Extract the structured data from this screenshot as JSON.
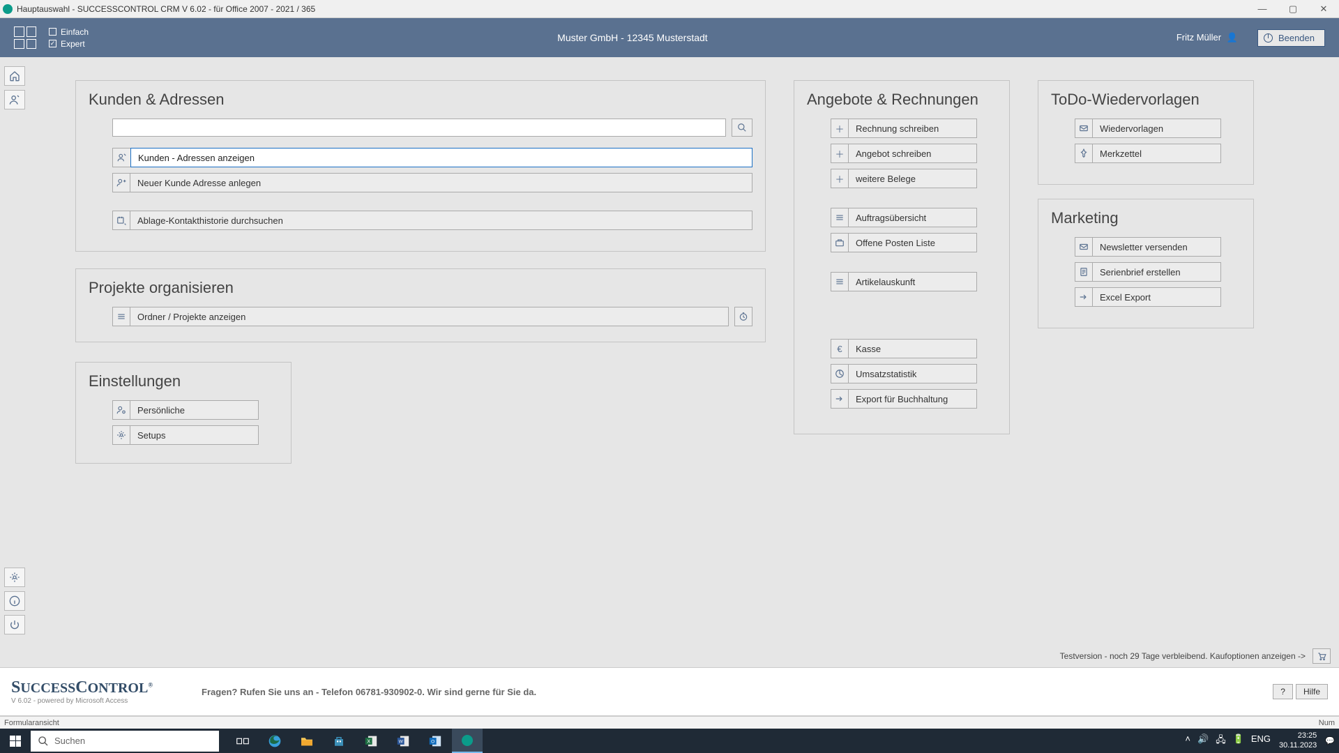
{
  "titlebar": {
    "title": "Hauptauswahl - SUCCESSCONTROL CRM V 6.02 - für Office 2007 - 2021 / 365"
  },
  "banner": {
    "mode_simple": "Einfach",
    "mode_expert": "Expert",
    "center": "Muster GmbH - 12345 Musterstadt",
    "user": "Fritz Müller",
    "exit": "Beenden"
  },
  "customers": {
    "title": "Kunden & Adressen",
    "show": "Kunden - Adressen anzeigen",
    "new": "Neuer Kunde Adresse anlegen",
    "history": "Ablage-Kontakthistorie durchsuchen"
  },
  "projects": {
    "title": "Projekte organisieren",
    "show": "Ordner / Projekte anzeigen"
  },
  "settings": {
    "title": "Einstellungen",
    "personal": "Persönliche",
    "setups": "Setups"
  },
  "offers": {
    "title": "Angebote & Rechnungen",
    "invoice": "Rechnung schreiben",
    "offer": "Angebot schreiben",
    "more": "weitere Belege",
    "overview": "Auftragsübersicht",
    "open": "Offene Posten Liste",
    "articles": "Artikelauskunft",
    "cash": "Kasse",
    "stats": "Umsatzstatistik",
    "export": "Export für Buchhaltung"
  },
  "todo": {
    "title": "ToDo-Wiedervorlagen",
    "resub": "Wiedervorlagen",
    "notes": "Merkzettel"
  },
  "marketing": {
    "title": "Marketing",
    "newsletter": "Newsletter versenden",
    "serial": "Serienbrief erstellen",
    "excel": "Excel Export"
  },
  "trial": "Testversion - noch 29 Tage verbleibend. Kaufoptionen anzeigen ->",
  "footer": {
    "logo": "SUCCESSCONTROL",
    "logo_sub": "V 6.02 - powered by Microsoft Access",
    "msg": "Fragen? Rufen Sie uns an - Telefon 06781-930902-0. Wir sind gerne für Sie da.",
    "q": "?",
    "help": "Hilfe"
  },
  "statusbar": {
    "left": "Formularansicht",
    "right": "Num"
  },
  "taskbar": {
    "search": "Suchen",
    "lang": "ENG",
    "time": "23:25",
    "date": "30.11.2023"
  }
}
